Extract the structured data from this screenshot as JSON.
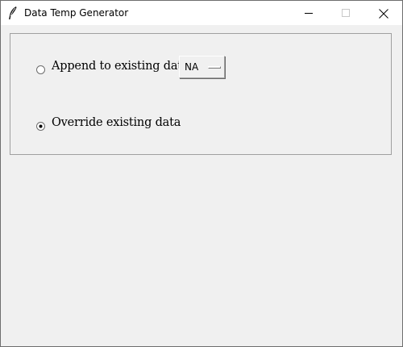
{
  "window": {
    "title": "Data Temp Generator"
  },
  "options": {
    "append_label": "Append to existing data",
    "append_selected": false,
    "override_label": "Override existing data",
    "override_selected": true
  },
  "dropdown": {
    "selected_value": "NA"
  },
  "icons": {
    "app": "feather-icon",
    "minimize": "minimize-icon",
    "maximize": "maximize-icon",
    "close": "close-icon"
  },
  "colors": {
    "titlebar_bg": "#ffffff",
    "window_bg": "#f0f0f0",
    "frame_border": "#a0a0a0"
  }
}
